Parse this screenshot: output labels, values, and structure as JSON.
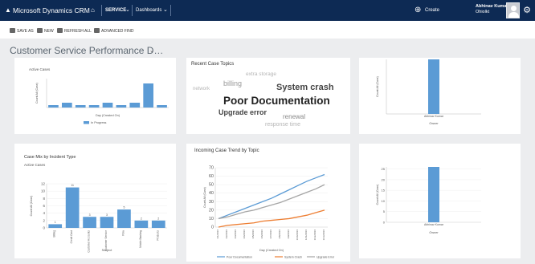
{
  "nav": {
    "app_name": "Microsoft Dynamics CRM",
    "app_caret": "⌄",
    "home_icon": "home-icon",
    "area": "SERVICE",
    "area_caret": "⌄",
    "section": "Dashboards",
    "section_caret": "⌄",
    "create_label": "Create",
    "user_name": "Abhinav Kumar",
    "user_org": "Ohiolkt",
    "settings_icon": "gear-icon"
  },
  "commands": {
    "save_as": "SAVE AS",
    "new": "NEW",
    "refresh_all": "REFRESH ALL",
    "advanced_find": "ADVANCED FIND"
  },
  "dashboard": {
    "title": "Customer Service Performance D…",
    "caret": "⌄"
  },
  "panels": {
    "active_cases": {
      "subtitle": "Active Cases"
    },
    "recent_topics": {
      "title": "Recent Case Topics"
    },
    "case_mix": {
      "title": "Case Mix by Incident Type",
      "subtitle": "Active Cases"
    },
    "trend": {
      "title": "Incoming Case Trend by Topic"
    }
  },
  "word_cloud": [
    {
      "text": "extra storage",
      "size": 6.5,
      "color": "#b5b5b5",
      "bold": false
    },
    {
      "text": "billing",
      "size": 9,
      "color": "#999999",
      "bold": false
    },
    {
      "text": "System crash",
      "size": 11,
      "color": "#444444",
      "bold": true
    },
    {
      "text": "network",
      "size": 6,
      "color": "#b5b5b5",
      "bold": false
    },
    {
      "text": "Poor Documentation",
      "size": 13.5,
      "color": "#222222",
      "bold": true
    },
    {
      "text": "Upgrade error",
      "size": 9,
      "color": "#444444",
      "bold": true
    },
    {
      "text": "renewal",
      "size": 8,
      "color": "#888888",
      "bold": false
    },
    {
      "text": "response time",
      "size": 7,
      "color": "#b5b5b5",
      "bold": false
    }
  ],
  "chart_data": [
    {
      "id": "active-cases",
      "type": "bar",
      "title": "Active Cases",
      "ylabel": "Count:All (Case)",
      "xlabel": "Day (Created On)",
      "categories": [
        "",
        "",
        "",
        "",
        "",
        "",
        "",
        "",
        ""
      ],
      "series": [
        {
          "name": "In Progress",
          "values": [
            1,
            2,
            1,
            1,
            2,
            1,
            2,
            10,
            1
          ]
        }
      ],
      "ylim": [
        0,
        12
      ],
      "color": "#5b9bd5"
    },
    {
      "id": "owner-top",
      "type": "bar",
      "ylabel": "Count:All (Case)",
      "xlabel": "Owner",
      "categories": [
        "Abhinav Kumar"
      ],
      "values": [
        26
      ],
      "ylim": [
        0,
        26
      ],
      "color": "#5b9bd5"
    },
    {
      "id": "case-mix",
      "type": "bar",
      "title": "Case Mix by Incident Type",
      "ylabel": "Count:All (Case)",
      "xlabel": "Subject",
      "categories": [
        "Billing",
        "Credit Card",
        "Customer Accounts",
        "Customer Service",
        "Flow",
        "Mobile Banking",
        "Products"
      ],
      "values": [
        1,
        11,
        3,
        3,
        5,
        2,
        2
      ],
      "yticks": [
        0,
        2,
        4,
        6,
        8,
        10,
        12
      ],
      "ylim": [
        0,
        12
      ],
      "color": "#5b9bd5"
    },
    {
      "id": "case-trend",
      "type": "line",
      "title": "Incoming Case Trend by Topic",
      "ylabel": "Count:All (Case)",
      "xlabel": "Day (Created On)",
      "categories": [
        "1/1/2016",
        "1/2/2016",
        "1/3/2016",
        "1/4/2016",
        "1/5/2016",
        "1/6/2016",
        "1/7/2016",
        "1/8/2016",
        "1/9/2016",
        "1/10/2016",
        "1/11/2016",
        "1/12/2016",
        "1/13/2016"
      ],
      "yticks": [
        0,
        10,
        20,
        30,
        40,
        50,
        60,
        70
      ],
      "ylim": [
        0,
        70
      ],
      "series": [
        {
          "name": "Poor Documentation",
          "color": "#5b9bd5",
          "values": [
            10,
            14,
            18,
            22,
            26,
            30,
            34,
            39,
            44,
            49,
            54,
            58,
            62
          ]
        },
        {
          "name": "System Crash",
          "color": "#ed7d31",
          "values": [
            0,
            2,
            3,
            4,
            5,
            7,
            8,
            9,
            10,
            12,
            14,
            17,
            20
          ]
        },
        {
          "name": "Upgrade Error",
          "color": "#a5a5a5",
          "values": [
            10,
            12,
            15,
            18,
            20,
            23,
            26,
            29,
            33,
            37,
            41,
            45,
            50
          ]
        }
      ]
    },
    {
      "id": "owner-bottom",
      "type": "bar",
      "ylabel": "Count:All (Case)",
      "xlabel": "Owner",
      "categories": [
        "Abhinav Kumar"
      ],
      "values": [
        26
      ],
      "yticks": [
        0,
        5,
        10,
        15,
        20,
        25
      ],
      "ylim": [
        0,
        26
      ],
      "color": "#5b9bd5"
    }
  ]
}
